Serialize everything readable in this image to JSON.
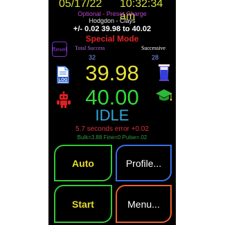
{
  "status": {
    "date": "05/17/22",
    "time": "10:32:34 am",
    "mode_line": "Optional - Preset Charge",
    "powder": "Hodgdon - Clays",
    "range": "+/- 0.02 39.98 to 40.02",
    "special": "Special Mode"
  },
  "counters": {
    "reset_label": "Reset",
    "total_label": "Total Success",
    "total_value": "32",
    "successive_label": "Successive",
    "successive_value": "28"
  },
  "readout": {
    "current_weight": "39.98",
    "target_weight": "40.00",
    "state": "IDLE",
    "timing": "5.7 seconds  error +0.02",
    "params": "Bulk=3.88 Fine=0 Pulse=.02"
  },
  "icons": {
    "log": "log-file-icon",
    "robot": "robot-icon",
    "beaker": "beaker-icon",
    "cap": "graduation-cap-icon",
    "log_text": "LOG"
  },
  "buttons": {
    "auto": "Auto",
    "profile": "Profile...",
    "start": "Start",
    "menu": "Menu..."
  },
  "colors": {
    "background": "#000000",
    "date_time": "#d8e23a",
    "mode_line": "#b846c8",
    "special": "#e02424",
    "current_weight": "#e8e13a",
    "target_weight": "#35d83a",
    "state": "#2fa8d8",
    "timing": "#d8343a",
    "params": "#2f9c3a",
    "green_border": "#34c83a",
    "blue_border": "#3b6fe8",
    "orange_border": "#e8602c"
  }
}
